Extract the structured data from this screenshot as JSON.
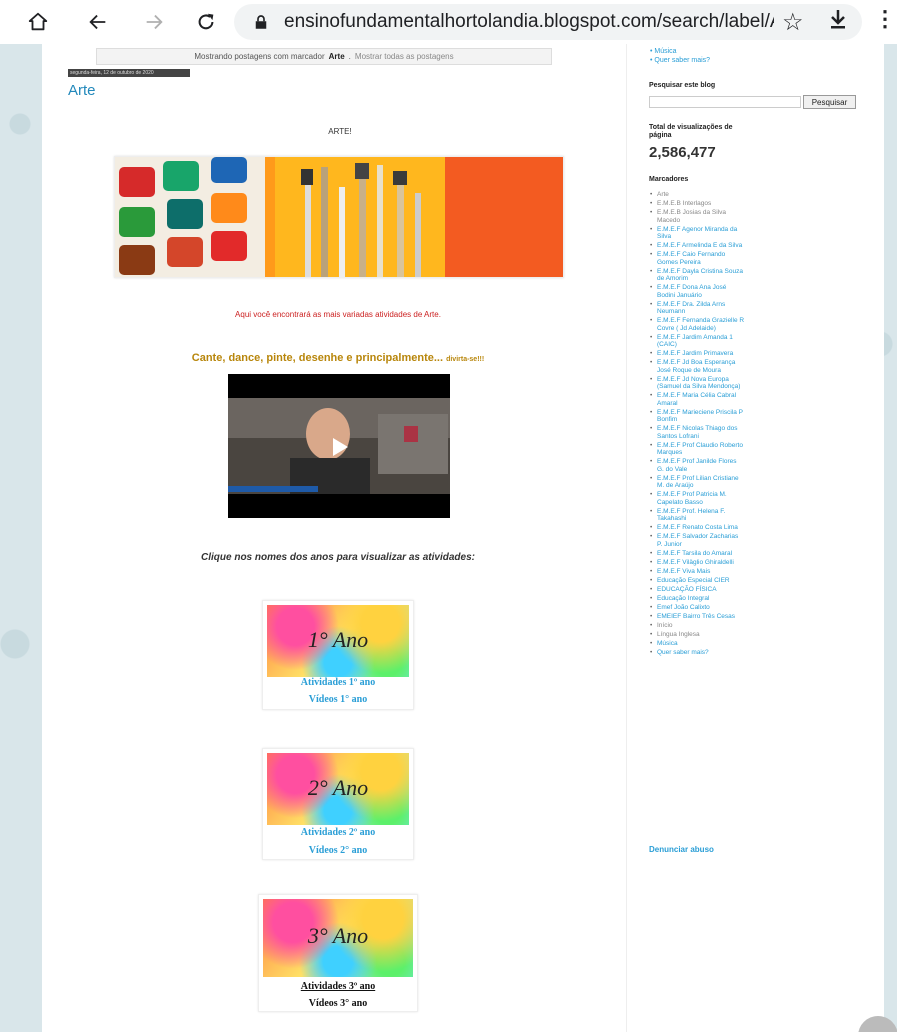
{
  "browser": {
    "url": "ensinofundamentalhortolandia.blogspot.com/search/label/A"
  },
  "status": {
    "prefix": "Mostrando postagens com marcador",
    "label": "Arte",
    "show_all": "Mostrar todas as postagens"
  },
  "post": {
    "date": "segunda-feira, 12 de outubro de 2020",
    "title": "Arte",
    "heading": "ARTE!",
    "intro": "Aqui você encontrará as mais variadas atividades de Arte.",
    "cante": "Cante, dance, pinte, desenhe e principalmente...",
    "cante_small": "divirta-se!!!",
    "click_instruction": "Clique nos nomes dos anos para visualizar as atividades:",
    "years": [
      {
        "thumb": "1° Ano",
        "activities": "Atividades 1º ano",
        "videos": "Vídeos 1° ano"
      },
      {
        "thumb": "2° Ano",
        "activities": "Atividades 2º ano",
        "videos": "Vídeos 2° ano"
      },
      {
        "thumb": "3° Ano",
        "activities": "Atividades 3º ano",
        "videos": "Vídeos 3° ano"
      }
    ]
  },
  "sidebar": {
    "top_items": [
      "Música",
      "Quer saber mais?"
    ],
    "search_heading": "Pesquisar este blog",
    "search_button": "Pesquisar",
    "views_heading": "Total de visualizações de página",
    "views_count": "2,586,477",
    "labels_heading": "Marcadores",
    "labels": [
      "Arte",
      "E.M.E.B Interlagos",
      "E.M.E.B Josias da Silva Macedo",
      "E.M.E.F Agenor Miranda da Silva",
      "E.M.E.F Armelinda E da Silva",
      "E.M.E.F Caio Fernando Gomes Pereira",
      "E.M.E.F Dayla Cristina Souza de Amorim",
      "E.M.E.F Dona Ana José Bodini Januário",
      "E.M.E.F Dra. Zilda Arns Neumann",
      "E.M.E.F Fernanda Grazielle R Covre ( Jd Adelaide)",
      "E.M.E.F Jardim Amanda 1 (CAIC)",
      "E.M.E.F Jardim Primavera",
      "E.M.E.F Jd Boa Esperança José Roque de Moura",
      "E.M.E.F Jd Nova Europa (Samuel da Silva Mendonça)",
      "E.M.E.F Maria Célia Cabral Amaral",
      "E.M.E.F Marieciene Priscila P Bonfim",
      "E.M.E.F Nicolas Thiago dos Santos Lofrani",
      "E.M.E.F Prof Claudio Roberto Marques",
      "E.M.E.F Prof Janilde Flores G. do Vale",
      "E.M.E.F Prof Lilian Cristiane M. de Araújo",
      "E.M.E.F Prof Patricia M. Capelato Basso",
      "E.M.E.F Prof. Helena F. Takahashi",
      "E.M.E.F Renato Costa Lima",
      "E.M.E.F Salvador Zacharias P. Junior",
      "E.M.E.F Tarsila do Amaral",
      "E.M.E.F Viläglio Ghiraldelli",
      "E.M.E.F Viva Mais",
      "Educação Especial CIER",
      "EDUCAÇÃO FÍSICA",
      "Educação Integral",
      "Emef João Calixto",
      "EMEIEF Bairro Três Cesas",
      "Início",
      "Língua Inglesa",
      "Música",
      "Quer saber mais?"
    ],
    "report": "Denunciar abuso"
  },
  "icons": {
    "home": "home-icon",
    "back": "back-arrow-icon",
    "forward": "forward-arrow-icon",
    "reload": "reload-icon",
    "lock": "lock-icon",
    "star": "star-icon",
    "download": "download-icon",
    "menu": "more-vert-icon",
    "play": "play-icon"
  }
}
